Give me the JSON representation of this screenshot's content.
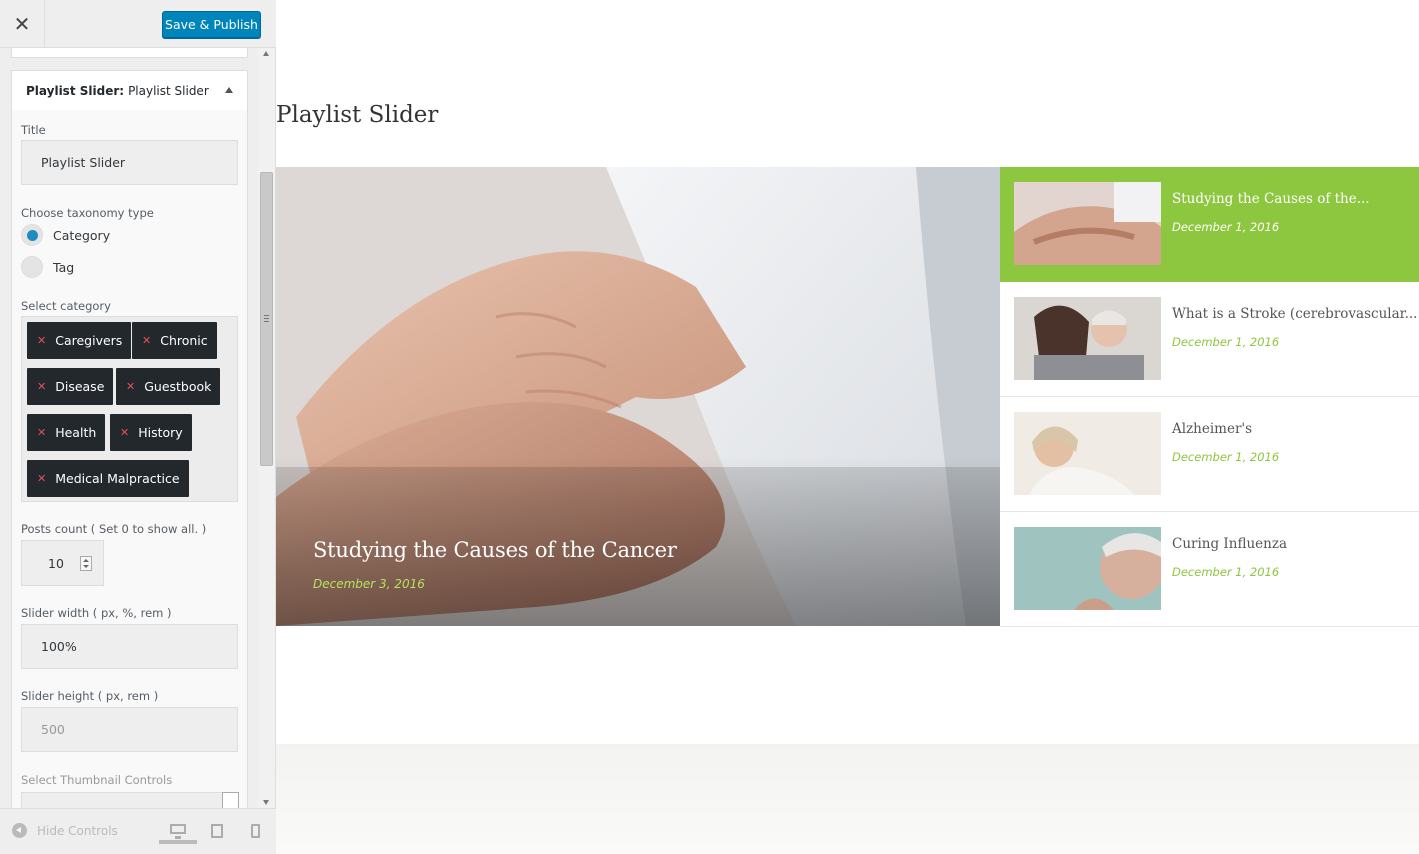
{
  "header": {
    "close_icon": "close-icon",
    "publish_label": "Save & Publish"
  },
  "widget": {
    "type_label": "Playlist Slider:",
    "name": "Playlist Slider",
    "title_label": "Title",
    "title_value": "Playlist Slider",
    "taxonomy_label": "Choose taxonomy type",
    "taxonomy_options": [
      {
        "label": "Category",
        "selected": true
      },
      {
        "label": "Tag",
        "selected": false
      }
    ],
    "category_label": "Select category",
    "categories": [
      "Caregivers",
      "Chronic",
      "Disease",
      "Guestbook",
      "Health",
      "History",
      "Medical Malpractice"
    ],
    "posts_count_label": "Posts count ( Set 0 to show all. )",
    "posts_count_value": "10",
    "slider_width_label": "Slider width ( px, %, rem )",
    "slider_width_value": "100%",
    "slider_height_label": "Slider height ( px, rem )",
    "slider_height_placeholder": "500",
    "thumbnail_controls_label": "Select Thumbnail Controls"
  },
  "footer": {
    "hide_controls_label": "Hide Controls",
    "devices": [
      "desktop-icon",
      "tablet-icon",
      "mobile-icon"
    ]
  },
  "preview": {
    "section_title": "Playlist Slider",
    "featured": {
      "title": "Studying the Causes of the Cancer",
      "date": "December 3, 2016"
    },
    "playlist": [
      {
        "title": "Studying the Causes of the...",
        "date": "December 1, 2016",
        "active": true
      },
      {
        "title": "What is a Stroke (cerebrovascular...",
        "date": "December 1, 2016",
        "active": false
      },
      {
        "title": "Alzheimer's",
        "date": "December 1, 2016",
        "active": false
      },
      {
        "title": "Curing Influenza",
        "date": "December 1, 2016",
        "active": false
      }
    ]
  },
  "colors": {
    "accent_green": "#8dc63f",
    "date_green": "#b7e25c",
    "publish_blue": "#0085ba",
    "tag_dark": "#23282d"
  }
}
